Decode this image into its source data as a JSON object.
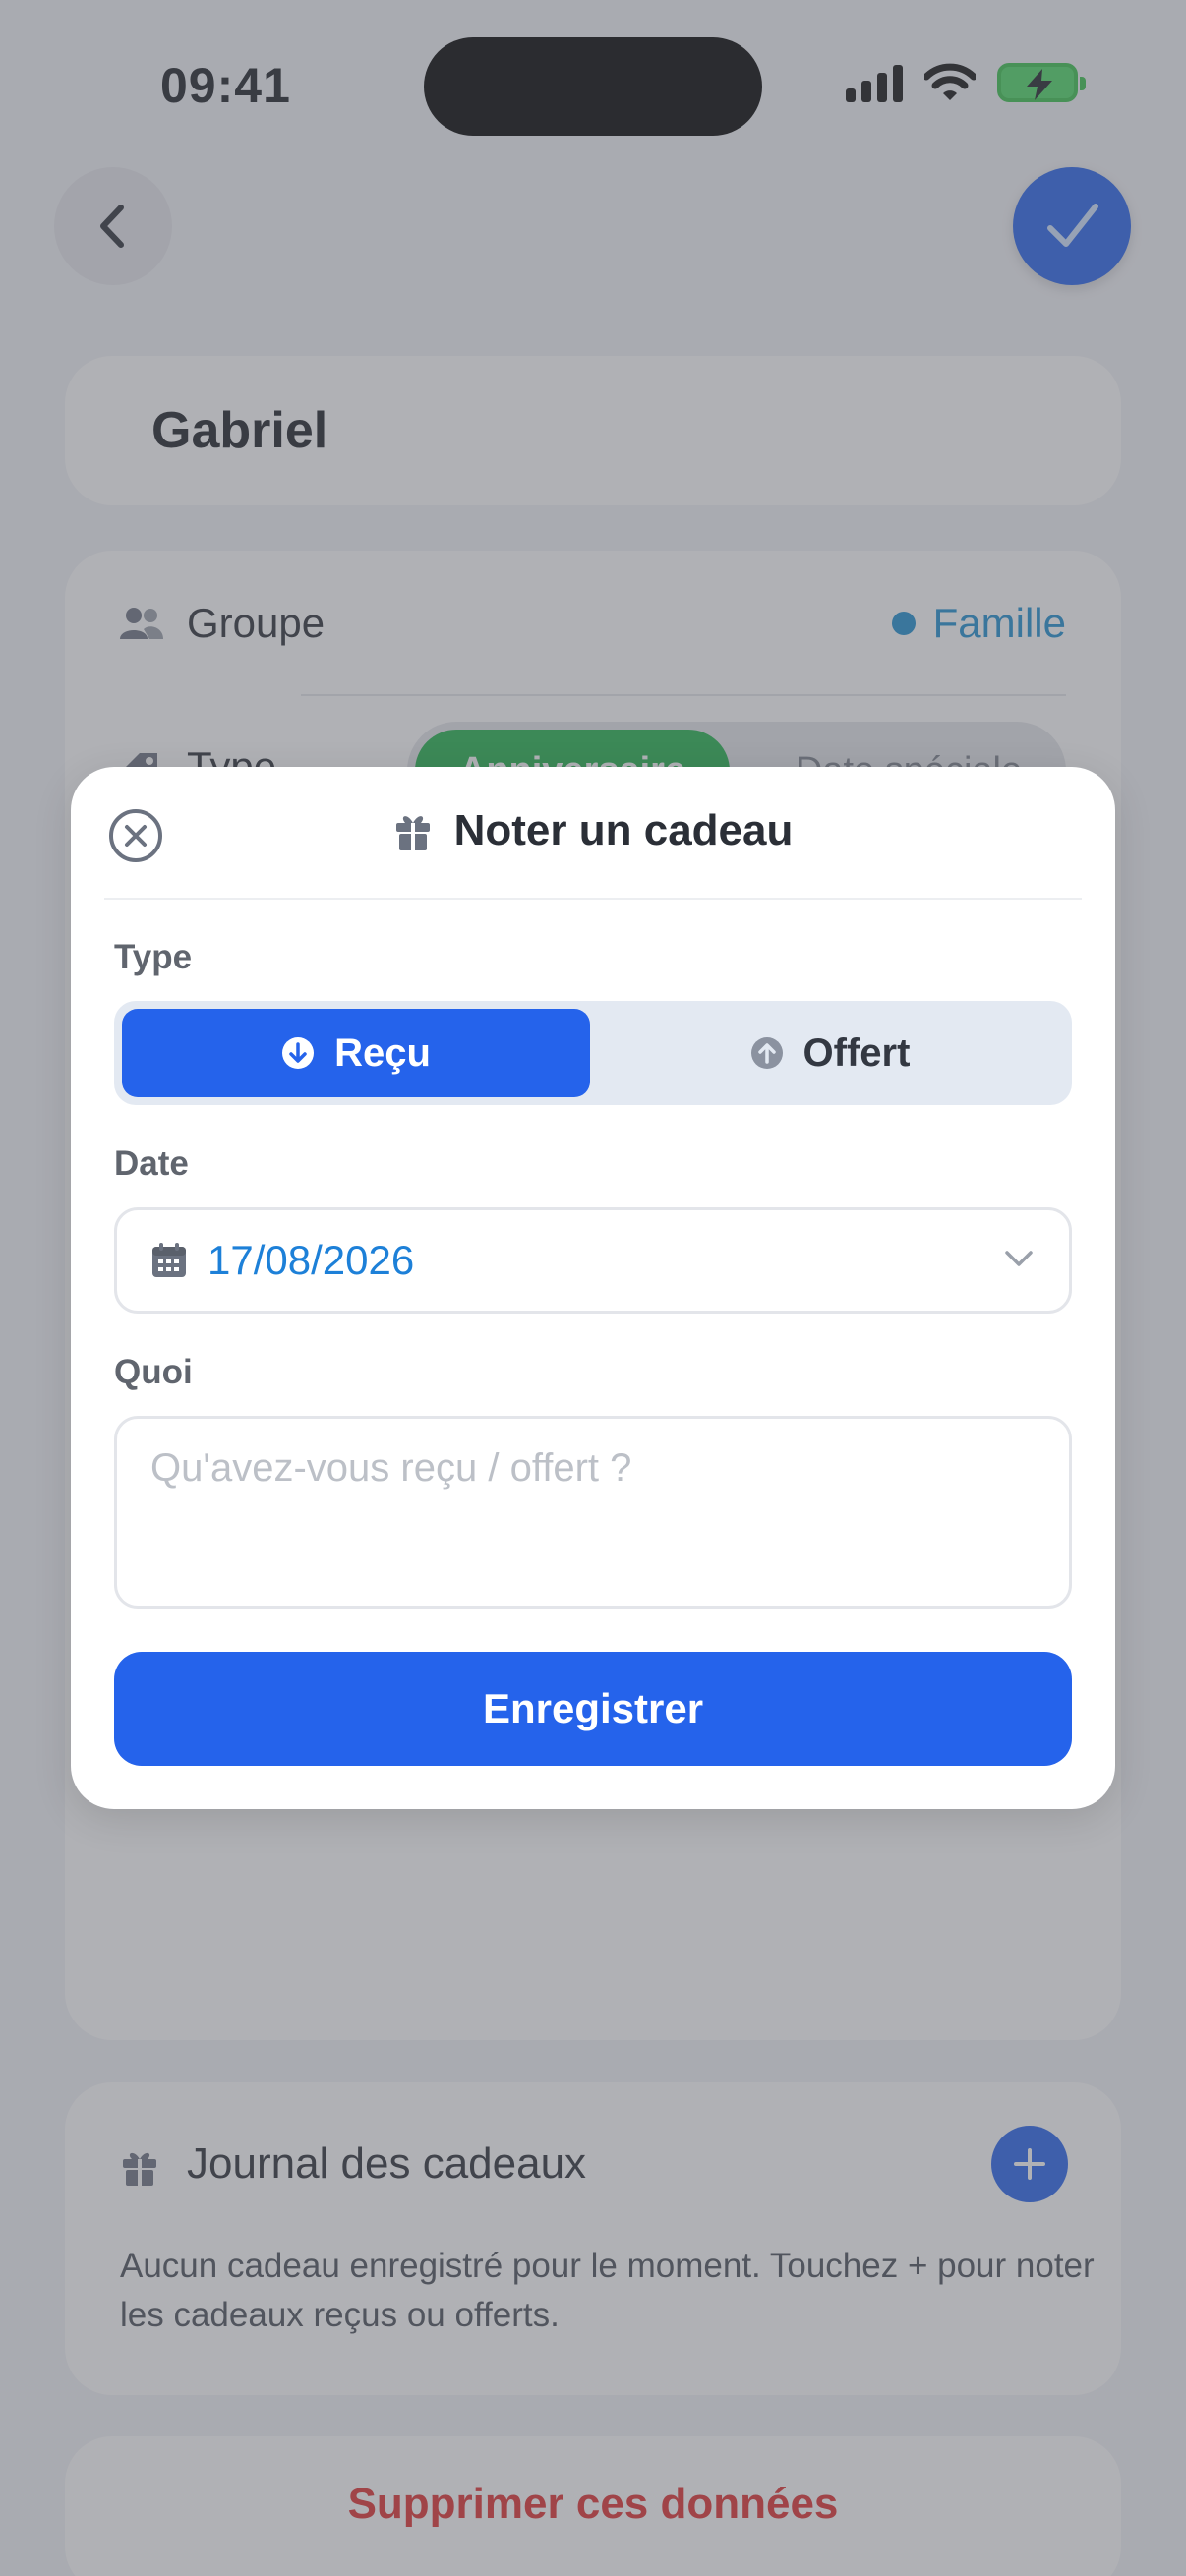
{
  "status_bar": {
    "time": "09:41"
  },
  "contact": {
    "name": "Gabriel"
  },
  "details": {
    "group_label": "Groupe",
    "group_value": "Famille",
    "type_label": "Type",
    "type_options": [
      "Anniversaire",
      "Date spéciale"
    ]
  },
  "journal": {
    "title": "Journal des cadeaux",
    "empty_text": "Aucun cadeau enregistré pour le moment. Touchez + pour noter les cadeaux reçus ou offerts."
  },
  "delete_label": "Supprimer ces données",
  "modal": {
    "title": "Noter un cadeau",
    "type_label": "Type",
    "type_received": "Reçu",
    "type_given": "Offert",
    "date_label": "Date",
    "date_value": "17/08/2026",
    "what_label": "Quoi",
    "what_placeholder": "Qu'avez-vous reçu / offert ?",
    "save_label": "Enregistrer"
  },
  "colors": {
    "accent": "#2563eb",
    "success": "#22b24c",
    "danger": "#e02f2f",
    "link": "#1d8fd0"
  }
}
